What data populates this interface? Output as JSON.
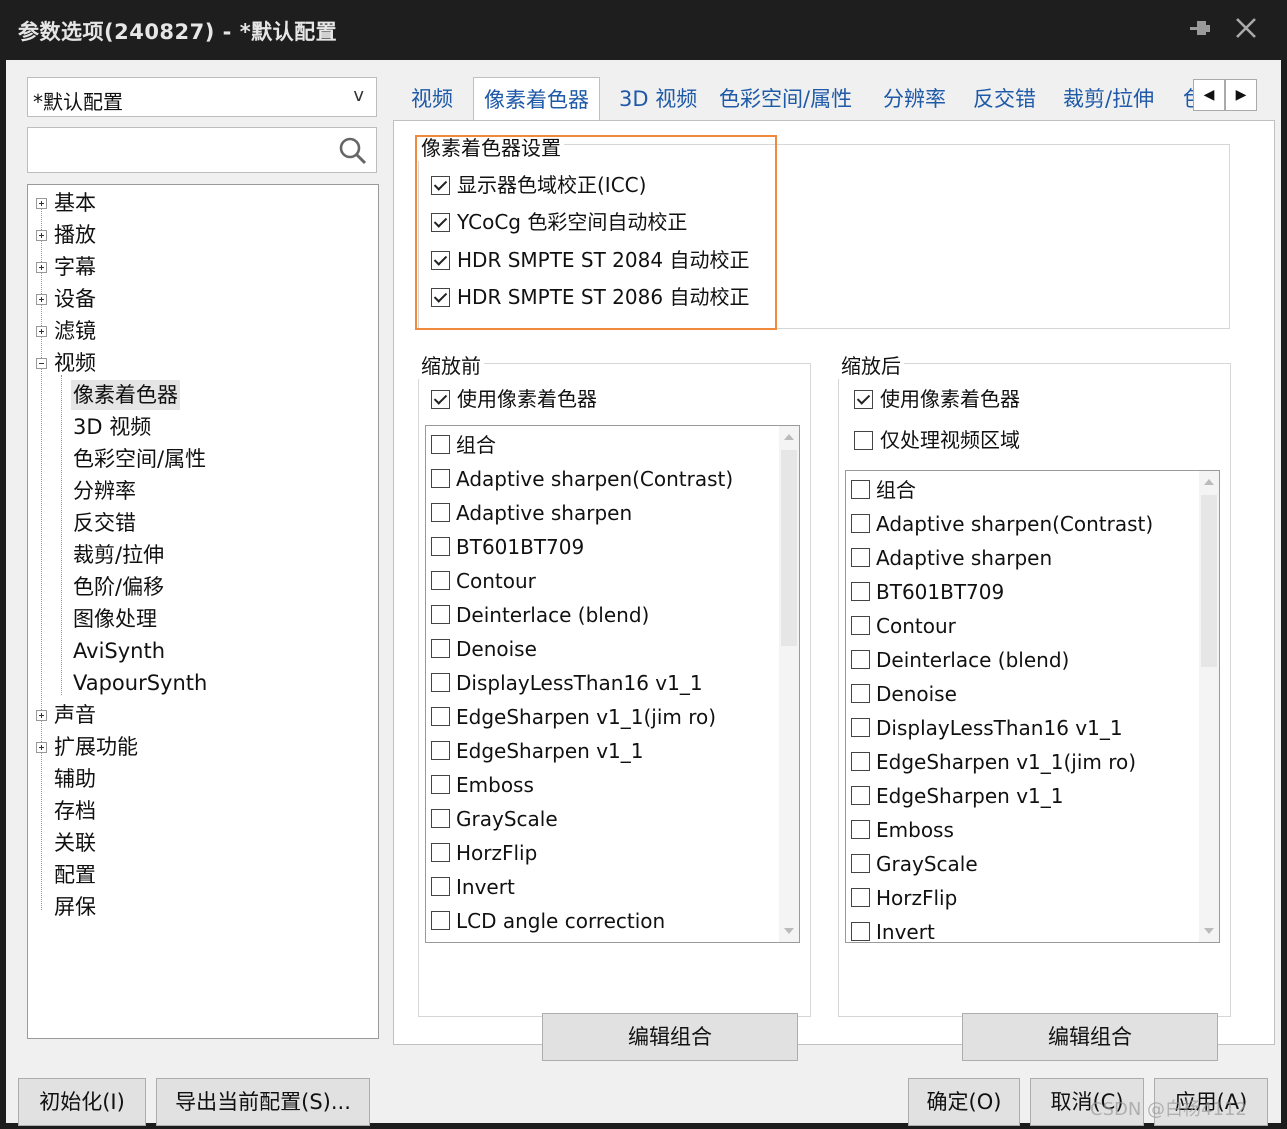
{
  "window": {
    "title": "参数选项(240827) - *默认配置"
  },
  "profile": {
    "value": "*默认配置",
    "arrow": "v"
  },
  "search": {
    "value": ""
  },
  "tree": {
    "top": [
      {
        "label": "基本",
        "expander": "plus"
      },
      {
        "label": "播放",
        "expander": "plus"
      },
      {
        "label": "字幕",
        "expander": "plus"
      },
      {
        "label": "设备",
        "expander": "plus"
      },
      {
        "label": "滤镜",
        "expander": "plus"
      },
      {
        "label": "视频",
        "expander": "minus"
      }
    ],
    "video_children": [
      "像素着色器",
      "3D 视频",
      "色彩空间/属性",
      "分辨率",
      "反交错",
      "裁剪/拉伸",
      "色阶/偏移",
      "图像处理",
      "AviSynth",
      "VapourSynth"
    ],
    "bottom": [
      {
        "label": "声音",
        "expander": "plus"
      },
      {
        "label": "扩展功能",
        "expander": "plus"
      },
      {
        "label": "辅助",
        "expander": "none"
      },
      {
        "label": "存档",
        "expander": "none"
      },
      {
        "label": "关联",
        "expander": "none"
      },
      {
        "label": "配置",
        "expander": "none"
      },
      {
        "label": "屏保",
        "expander": "none"
      }
    ],
    "selected": "像素着色器"
  },
  "tabs": [
    "视频",
    "像素着色器",
    "3D 视频",
    "色彩空间/属性",
    "分辨率",
    "反交错",
    "裁剪/拉伸",
    "色"
  ],
  "active_tab": "像素着色器",
  "shader_settings": {
    "label": "像素着色器设置",
    "options": [
      {
        "label": "显示器色域校正(ICC)",
        "checked": true
      },
      {
        "label": "YCoCg 色彩空间自动校正",
        "checked": true
      },
      {
        "label": "HDR SMPTE ST 2084 自动校正",
        "checked": true
      },
      {
        "label": "HDR SMPTE ST 2086 自动校正",
        "checked": true
      }
    ]
  },
  "pre_resize": {
    "label": "缩放前",
    "use_shader": {
      "label": "使用像素着色器",
      "checked": true
    },
    "items": [
      "组合",
      "Adaptive sharpen(Contrast)",
      "Adaptive sharpen",
      "BT601BT709",
      "Contour",
      "Deinterlace (blend)",
      "Denoise",
      "DisplayLessThan16 v1_1",
      "EdgeSharpen v1_1(jim ro)",
      "EdgeSharpen v1_1",
      "Emboss",
      "GrayScale",
      "HorzFlip",
      "Invert",
      "LCD angle correction"
    ],
    "edit_button": "编辑组合"
  },
  "post_resize": {
    "label": "缩放后",
    "use_shader": {
      "label": "使用像素着色器",
      "checked": true
    },
    "video_area_only": {
      "label": "仅处理视频区域",
      "checked": false
    },
    "items": [
      "组合",
      "Adaptive sharpen(Contrast)",
      "Adaptive sharpen",
      "BT601BT709",
      "Contour",
      "Deinterlace (blend)",
      "Denoise",
      "DisplayLessThan16 v1_1",
      "EdgeSharpen v1_1(jim ro)",
      "EdgeSharpen v1_1",
      "Emboss",
      "GrayScale",
      "HorzFlip",
      "Invert"
    ],
    "edit_button": "编辑组合"
  },
  "footer": {
    "reset": "初始化(I)",
    "export": "导出当前配置(S)...",
    "ok": "确定(O)",
    "cancel": "取消(C)",
    "apply": "应用(A)"
  },
  "watermark": "CSDN @白杨4112",
  "colors": {
    "highlight": "#f0883e",
    "tab_text": "#1e5aa8",
    "titlebar": "#1e1e1e"
  }
}
